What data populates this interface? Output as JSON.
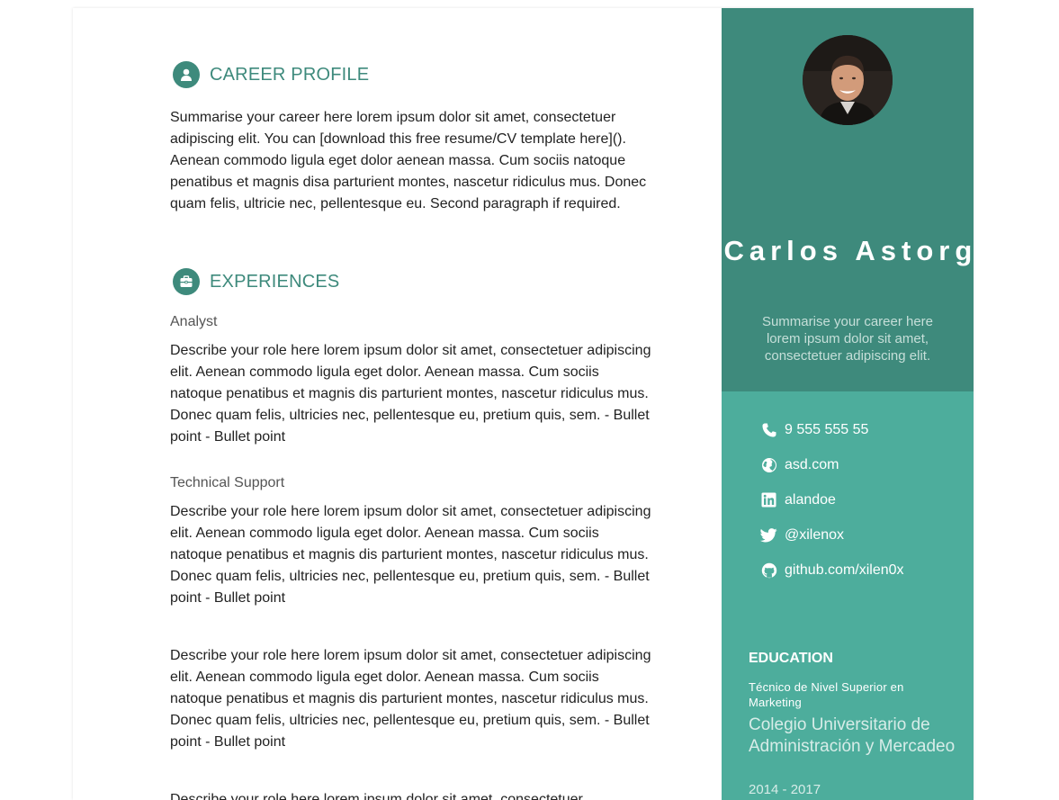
{
  "career_profile": {
    "heading": "CAREER PROFILE",
    "summary": "Summarise your career here lorem ipsum dolor sit amet, consectetuer adipiscing elit. You can [download this free resume/CV template here](). Aenean commodo ligula eget dolor aenean massa. Cum sociis natoque penatibus et magnis disa parturient montes, nascetur ridiculus mus. Donec quam felis, ultricie nec, pellentesque eu. Second paragraph if required."
  },
  "experiences": {
    "heading": "EXPERIENCES",
    "items": [
      {
        "title": "Analyst",
        "description": "Describe your role here lorem ipsum dolor sit amet, consectetuer adipiscing elit. Aenean commodo ligula eget dolor. Aenean massa. Cum sociis natoque penatibus et magnis dis parturient montes, nascetur ridiculus mus. Donec quam felis, ultricies nec, pellentesque eu, pretium quis, sem. - Bullet point - Bullet point"
      },
      {
        "title": "Technical Support",
        "description": "Describe your role here lorem ipsum dolor sit amet, consectetuer adipiscing elit. Aenean commodo ligula eget dolor. Aenean massa. Cum sociis natoque penatibus et magnis dis parturient montes, nascetur ridiculus mus. Donec quam felis, ultricies nec, pellentesque eu, pretium quis, sem. - Bullet point - Bullet point"
      },
      {
        "title": "",
        "description": "Describe your role here lorem ipsum dolor sit amet, consectetuer adipiscing elit. Aenean commodo ligula eget dolor. Aenean massa. Cum sociis natoque penatibus et magnis dis parturient montes, nascetur ridiculus mus. Donec quam felis, ultricies nec, pellentesque eu, pretium quis, sem. - Bullet point - Bullet point"
      },
      {
        "title": "",
        "description": "Describe your role here lorem ipsum dolor sit amet, consectetuer"
      }
    ]
  },
  "sidebar": {
    "name": "Carlos Astorga",
    "tagline": "Summarise your career here lorem ipsum dolor sit amet, consectetuer adipiscing elit.",
    "contacts": [
      {
        "icon": "phone-icon",
        "text": "9 555 555 55"
      },
      {
        "icon": "globe-icon",
        "text": "asd.com"
      },
      {
        "icon": "linkedin-icon",
        "text": "alandoe"
      },
      {
        "icon": "twitter-icon",
        "text": "@xilenox"
      },
      {
        "icon": "github-icon",
        "text": "github.com/xilen0x"
      }
    ],
    "education": {
      "heading": "EDUCATION",
      "degree": "Técnico de Nivel Superior en Marketing",
      "school": "Colegio Universitario de Administración y Mercadeo",
      "years": "2014 - 2017"
    }
  },
  "colors": {
    "accent": "#3e8a7c",
    "sidebar_light": "#4dad9c",
    "text": "#222222"
  }
}
